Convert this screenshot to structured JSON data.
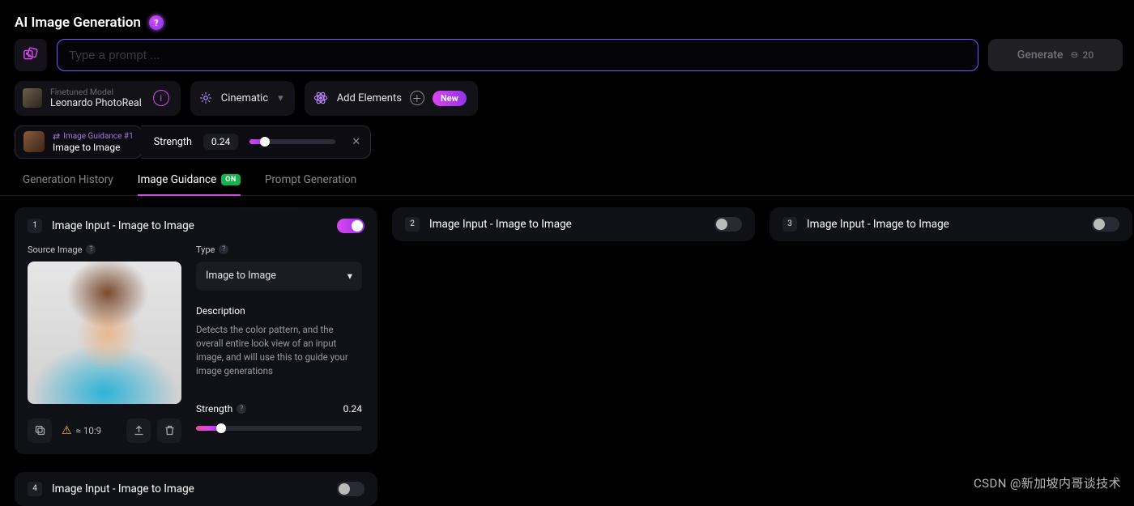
{
  "header": {
    "title": "AI Image Generation",
    "badge": "?"
  },
  "prompt": {
    "placeholder": "Type a prompt ..."
  },
  "generate": {
    "label": "Generate",
    "credits": "20"
  },
  "model": {
    "sub": "Finetuned Model",
    "name": "Leonardo PhotoReal"
  },
  "style": {
    "label": "Cinematic"
  },
  "elements": {
    "label": "Add Elements",
    "badge": "New"
  },
  "guidance_chip": {
    "sub": "Image Guidance #1",
    "main": "Image to Image",
    "strength_label": "Strength",
    "strength_value": "0.24",
    "strength_percent": 18
  },
  "tabs": {
    "history": "Generation History",
    "guidance": "Image Guidance",
    "guidance_badge": "ON",
    "promptgen": "Prompt Generation"
  },
  "cards": {
    "c1": {
      "num": "1",
      "title": "Image Input - Image to Image",
      "source_label": "Source Image",
      "type_label": "Type",
      "type_value": "Image to Image",
      "desc_head": "Description",
      "desc_text": "Detects the color pattern, and the overall entire look view of an input image, and will use this to guide your image generations",
      "strength_label": "Strength",
      "strength_value": "0.24",
      "strength_percent": 15,
      "ratio": "≈ 10:9"
    },
    "c2": {
      "num": "2",
      "title": "Image Input - Image to Image"
    },
    "c3": {
      "num": "3",
      "title": "Image Input - Image to Image"
    },
    "c4": {
      "num": "4",
      "title": "Image Input - Image to Image"
    }
  },
  "watermark": "CSDN @新加坡内哥谈技术"
}
